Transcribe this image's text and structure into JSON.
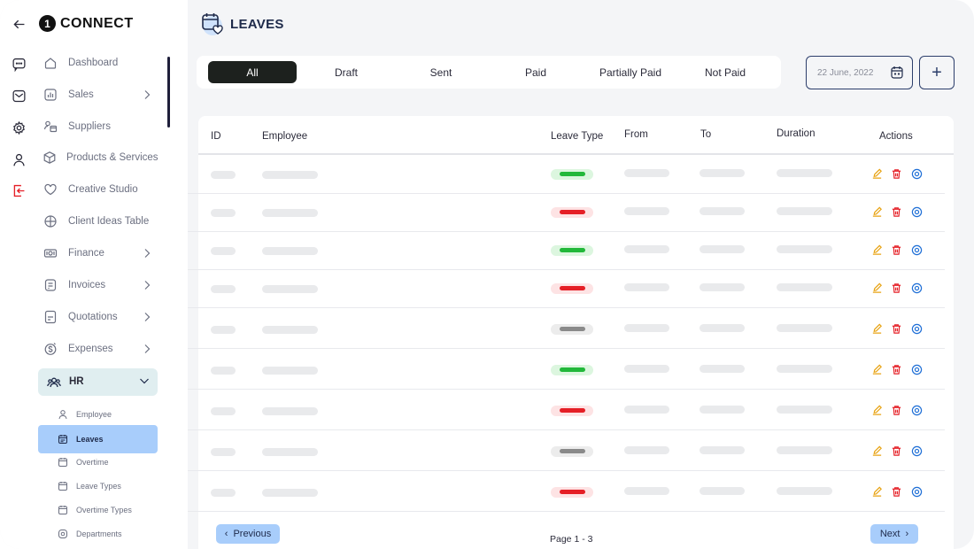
{
  "app": {
    "logo_mark": "1",
    "logo_text": "CONNECT"
  },
  "rail": [
    {
      "icon": "back-arrow-icon"
    },
    {
      "icon": "chat-icon"
    },
    {
      "icon": "mail-icon"
    },
    {
      "icon": "gear-icon"
    },
    {
      "icon": "user-icon"
    },
    {
      "icon": "logout-icon"
    }
  ],
  "sidebar": {
    "items": [
      {
        "label": "Dashboard",
        "icon": "home-icon",
        "chevron": false
      },
      {
        "label": "Sales",
        "icon": "chart-icon",
        "chevron": true
      },
      {
        "label": "Suppliers",
        "icon": "suppliers-icon",
        "chevron": false
      },
      {
        "label": "Products & Services",
        "icon": "box-icon",
        "chevron": false
      },
      {
        "label": "Creative Studio",
        "icon": "heart-icon",
        "chevron": false
      },
      {
        "label": "Client Ideas Table",
        "icon": "grid-icon",
        "chevron": false
      },
      {
        "label": "Finance",
        "icon": "cash-icon",
        "chevron": true
      },
      {
        "label": "Invoices",
        "icon": "invoice-icon",
        "chevron": true
      },
      {
        "label": "Quotations",
        "icon": "quote-icon",
        "chevron": true
      },
      {
        "label": "Expenses",
        "icon": "dollar-icon",
        "chevron": true
      }
    ],
    "hr": {
      "label": "HR",
      "icon": "team-icon"
    },
    "hr_items": [
      {
        "label": "Employee",
        "icon": "user-icon",
        "active": false
      },
      {
        "label": "Leaves",
        "icon": "calendar-icon",
        "active": true
      },
      {
        "label": "Overtime",
        "icon": "calendar-icon",
        "active": false
      },
      {
        "label": "Leave Types",
        "icon": "calendar-icon",
        "active": false
      },
      {
        "label": "Overtime Types",
        "icon": "calendar-icon",
        "active": false
      },
      {
        "label": "Departments",
        "icon": "department-icon",
        "active": false
      }
    ]
  },
  "header": {
    "title": "LEAVES"
  },
  "filters": [
    "All",
    "Draft",
    "Sent",
    "Paid",
    "Partially Paid",
    "Not Paid"
  ],
  "date": {
    "value": "22 June, 2022"
  },
  "add_label": "+",
  "colors": {
    "green": "#22b83a",
    "green_bg": "#dcf6df",
    "red": "#e51f26",
    "red_bg": "#fde3e4",
    "gray": "#8a8a8a",
    "gray_bg": "#ececec"
  },
  "table": {
    "columns": [
      "ID",
      "Employee",
      "Leave Type",
      "From",
      "To",
      "Duration",
      "Actions"
    ],
    "rows": [
      {
        "leave_type": "green"
      },
      {
        "leave_type": "red"
      },
      {
        "leave_type": "green"
      },
      {
        "leave_type": "red"
      },
      {
        "leave_type": "gray"
      },
      {
        "leave_type": "green"
      },
      {
        "leave_type": "red"
      },
      {
        "leave_type": "gray"
      },
      {
        "leave_type": "red"
      }
    ]
  },
  "pagination": {
    "previous": "Previous",
    "next": "Next",
    "info": "Page 1 - 3"
  }
}
